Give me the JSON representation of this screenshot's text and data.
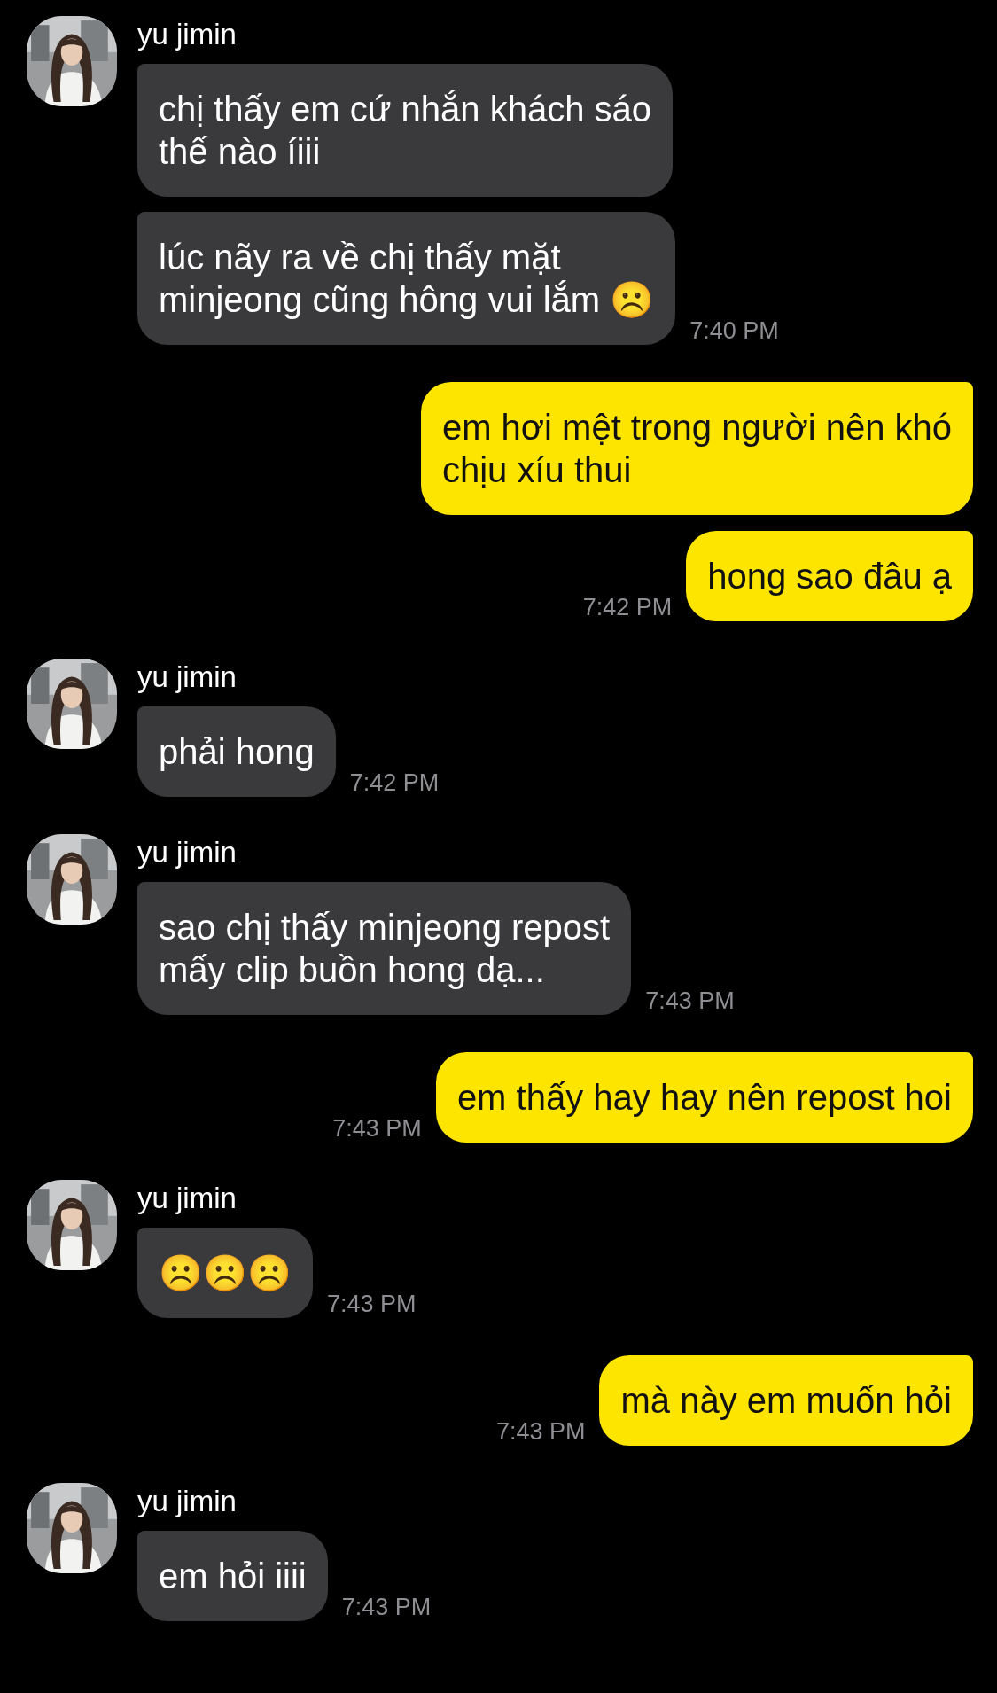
{
  "messages": [
    {
      "kind": "incoming",
      "sender": "yu jimin",
      "bubbles": [
        "chị thấy em cứ nhắn khách sáo\nthế nào íiii",
        "lúc nãy ra về chị thấy mặt\nminjeong cũng hông vui lắm ☹️"
      ],
      "time": "7:40 PM"
    },
    {
      "kind": "outgoing",
      "bubbles": [
        "em hơi mệt trong người nên khó\nchịu xíu thui",
        "hong sao đâu ạ"
      ],
      "time": "7:42 PM"
    },
    {
      "kind": "incoming",
      "sender": "yu jimin",
      "bubbles": [
        "phải hong"
      ],
      "time": "7:42 PM"
    },
    {
      "kind": "incoming",
      "sender": "yu jimin",
      "bubbles": [
        "sao chị thấy minjeong repost\nmấy clip buồn hong dạ..."
      ],
      "time": "7:43 PM"
    },
    {
      "kind": "outgoing",
      "bubbles": [
        "em thấy hay hay nên repost hoi"
      ],
      "time": "7:43 PM"
    },
    {
      "kind": "incoming",
      "sender": "yu jimin",
      "bubbles": [
        "☹️☹️☹️"
      ],
      "time": "7:43 PM"
    },
    {
      "kind": "outgoing",
      "bubbles": [
        "mà này em muốn hỏi"
      ],
      "time": "7:43 PM"
    },
    {
      "kind": "incoming",
      "sender": "yu jimin",
      "bubbles": [
        "em hỏi iiii"
      ],
      "time": "7:43 PM"
    }
  ]
}
